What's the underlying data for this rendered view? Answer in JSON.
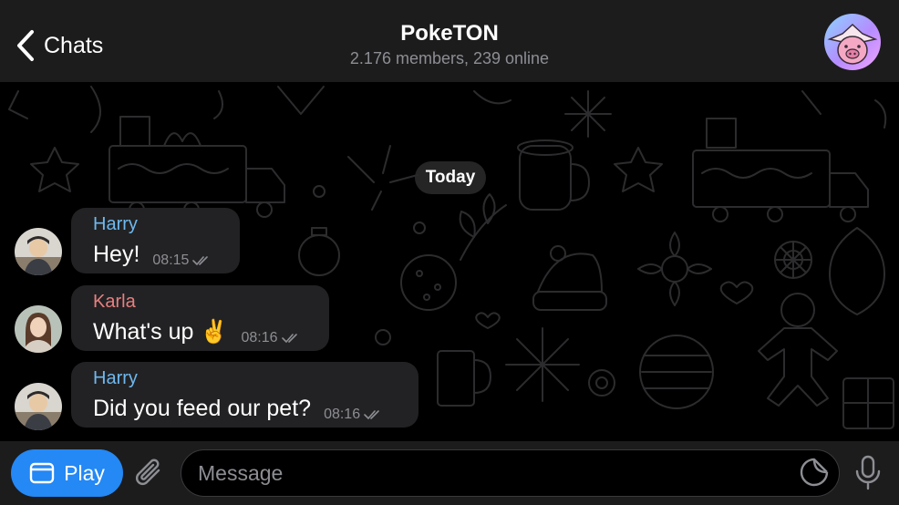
{
  "header": {
    "back_label": "Chats",
    "title": "PokeTON",
    "subtitle": "2.176 members, 239 online"
  },
  "date_separator": "Today",
  "messages": [
    {
      "sender": "Harry",
      "sender_color": "#6fb8ee",
      "text": "Hey!",
      "time": "08:15"
    },
    {
      "sender": "Karla",
      "sender_color": "#e97f7f",
      "text": "What's up ✌️",
      "time": "08:16"
    },
    {
      "sender": "Harry",
      "sender_color": "#6fb8ee",
      "text": "Did you feed our pet?",
      "time": "08:16"
    }
  ],
  "input": {
    "play_label": "Play",
    "placeholder": "Message"
  },
  "colors": {
    "accent": "#2488f5",
    "header_bg": "#1c1c1d",
    "bubble_bg": "#222224",
    "muted_text": "#8d8e93"
  },
  "icons": {
    "back": "chevron-left-icon",
    "play": "window-icon",
    "attach": "paperclip-icon",
    "sticker": "sticker-icon",
    "mic": "microphone-icon",
    "read": "double-check-icon"
  }
}
